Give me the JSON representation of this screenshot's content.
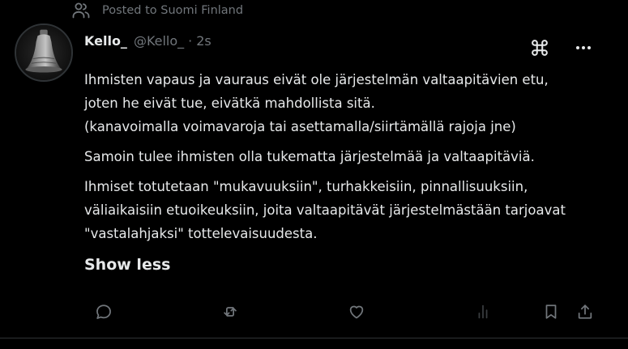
{
  "context": {
    "icon": "community-icon",
    "text": "Posted to Suomi Finland"
  },
  "post": {
    "author": {
      "display_name": "Kello_",
      "handle": "@Kello_",
      "separator": "·",
      "time": "2s",
      "avatar": "bell-avatar"
    },
    "paragraphs": [
      {
        "lines": [
          "Ihmisten vapaus ja vauraus eivät ole järjestelmän valtaapitävien etu,",
          "joten he eivät tue, eivätkä mahdollista sitä.",
          "(kanavoimalla voimavaroja tai asettamalla/siirtämällä rajoja jne)"
        ]
      },
      {
        "lines": [
          "Samoin tulee ihmisten olla tukematta järjestelmää ja valtaapitäviä."
        ]
      },
      {
        "lines": [
          "Ihmiset totutetaan \"mukavuuksiin\", turhakkeisiin, pinnallisuuksiin,",
          "väliaikaisiin etuoikeuksiin, joita valtaapitävät järjestelmästään tarjoavat",
          "\"vastalahjaksi\" tottelevaisuudesta."
        ]
      }
    ],
    "show_less_label": "Show less"
  },
  "top_icons": [
    "grok-icon",
    "more-icon"
  ],
  "actions": [
    "reply-icon",
    "repost-icon",
    "like-icon",
    "views-icon",
    "bookmark-icon",
    "share-icon"
  ],
  "colors": {
    "background": "#000000",
    "text": "#e7e9ea",
    "muted": "#71767b",
    "divider": "#2f3336"
  }
}
